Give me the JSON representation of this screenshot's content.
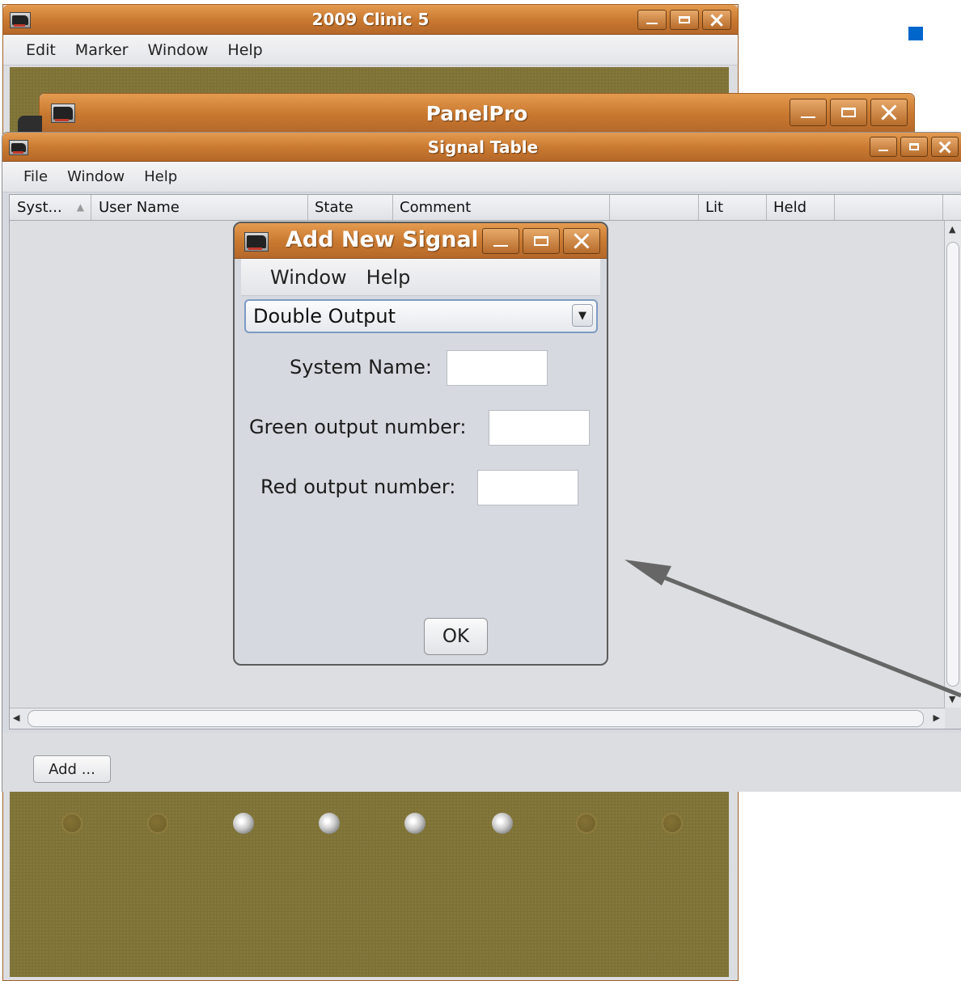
{
  "clinic_window": {
    "title": "2009 Clinic 5",
    "menu": [
      "Edit",
      "Marker",
      "Window",
      "Help"
    ],
    "panel_color": "#7e7237",
    "indicators": [
      "off",
      "off",
      "on",
      "on",
      "on",
      "on",
      "off",
      "off"
    ]
  },
  "panelpro_window": {
    "title": "PanelPro"
  },
  "signal_table_window": {
    "title": "Signal Table",
    "menu": [
      "File",
      "Window",
      "Help"
    ],
    "columns": [
      "Syst...",
      "User Name",
      "State",
      "Comment",
      "",
      "Lit",
      "Held",
      ""
    ],
    "add_button": "Add ..."
  },
  "add_signal_dialog": {
    "title": "Add New Signal",
    "menu": [
      "Window",
      "Help"
    ],
    "type_select": {
      "selected": "Double Output"
    },
    "fields": {
      "system_name": {
        "label": "System Name:",
        "value": ""
      },
      "green_output": {
        "label": "Green output number:",
        "value": ""
      },
      "red_output": {
        "label": "Red output number:",
        "value": ""
      }
    },
    "ok_button": "OK"
  },
  "theme": {
    "titlebar": "#c8782f",
    "window_bg": "#d6d9df",
    "accent": "#0066cc",
    "arrow": "#666666"
  }
}
